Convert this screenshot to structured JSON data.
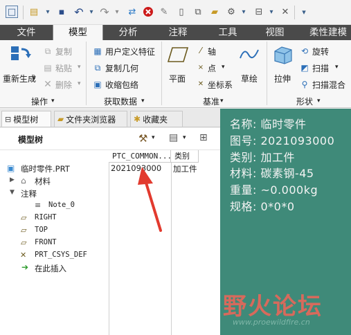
{
  "quick_access": {
    "icons": [
      "window-icon",
      "new-icon",
      "save-icon",
      "undo-icon",
      "redo-icon",
      "regenerate-icon",
      "close-window-icon",
      "stop-icon",
      "file-icon",
      "window-switch-icon",
      "open-icon",
      "settings-icon",
      "display-icon",
      "close-icon",
      "more-icon"
    ]
  },
  "tabs": [
    "文件",
    "模型",
    "分析",
    "注释",
    "工具",
    "视图",
    "柔性建模"
  ],
  "active_tab": "模型",
  "ribbon": {
    "operations": {
      "regenerate": "重新生成",
      "copy": "复制",
      "paste": "粘贴",
      "delete": "删除",
      "group_label": "操作"
    },
    "get_data": {
      "udf": "用户定义特征",
      "copy_geom": "复制几何",
      "shrinkwrap": "收缩包络",
      "group_label": "获取数据"
    },
    "datum": {
      "plane": "平面",
      "axis": "轴",
      "point": "点",
      "csys": "坐标系",
      "sketch": "草绘",
      "group_label": "基准"
    },
    "shapes": {
      "extrude": "拉伸",
      "revolve": "旋转",
      "sweep": "扫描",
      "swept_blend": "扫描混合",
      "group_label": "形状"
    }
  },
  "panel_tabs": [
    "模型树",
    "文件夹浏览器",
    "收藏夹"
  ],
  "tree": {
    "title": "模型树",
    "col_param": "PTC_COMMON...",
    "col_type": "类别",
    "nodes": [
      {
        "label": "临时零件.PRT",
        "param": "2021093000",
        "type": "加工件"
      },
      {
        "label": "材料",
        "param": "",
        "type": ""
      },
      {
        "label": "注释",
        "param": "",
        "type": ""
      },
      {
        "label": "Note_0",
        "param": "",
        "type": ""
      },
      {
        "label": "RIGHT",
        "param": "",
        "type": ""
      },
      {
        "label": "TOP",
        "param": "",
        "type": ""
      },
      {
        "label": "FRONT",
        "param": "",
        "type": ""
      },
      {
        "label": "PRT_CSYS_DEF",
        "param": "",
        "type": ""
      },
      {
        "label": "在此插入",
        "param": "",
        "type": ""
      }
    ]
  },
  "info": {
    "name": "名称: 临时零件",
    "number": "图号: 2021093000",
    "category": "类别: 加工件",
    "material": "材料: 碳素钢-45",
    "weight": "重量: ~0.000kg",
    "spec": "规格: 0*0*0"
  },
  "watermark": {
    "text": "野火论坛",
    "url": "www.proewildfire.cn"
  },
  "colors": {
    "tab_bar": "#4a4a4a",
    "info_bg": "#3f8a79",
    "arrow": "#e23a2e",
    "watermark": "#d76a5c"
  }
}
